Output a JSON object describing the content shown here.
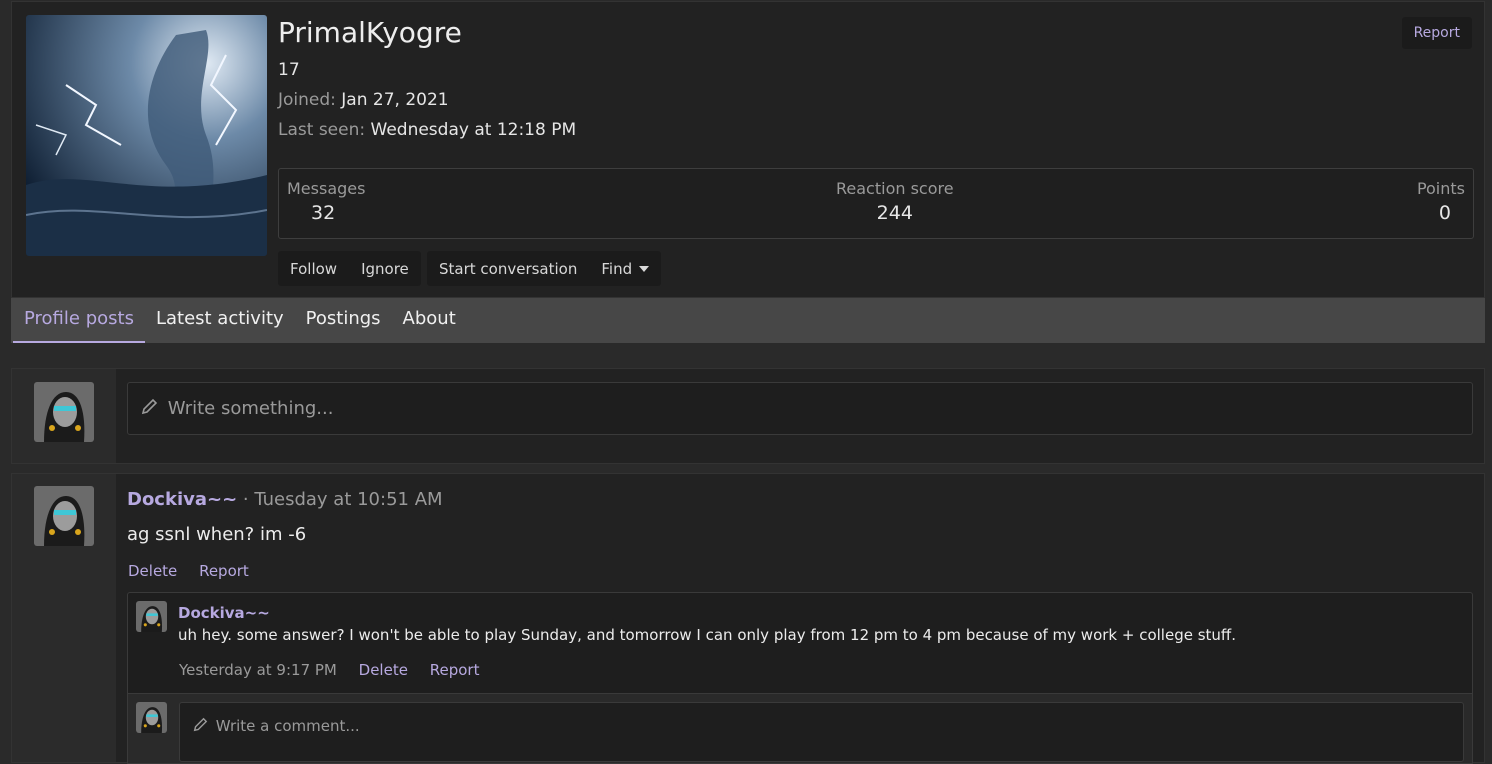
{
  "profile": {
    "username": "PrimalKyogre",
    "title": "17",
    "joined_label": "Joined:",
    "joined_value": "Jan 27, 2021",
    "last_seen_label": "Last seen:",
    "last_seen_value": "Wednesday at 12:18 PM",
    "report_label": "Report",
    "stats": {
      "messages_label": "Messages",
      "messages_value": "32",
      "reaction_label": "Reaction score",
      "reaction_value": "244",
      "points_label": "Points",
      "points_value": "0"
    },
    "buttons": {
      "follow": "Follow",
      "ignore": "Ignore",
      "start_conversation": "Start conversation",
      "find": "Find"
    }
  },
  "tabs": [
    "Profile posts",
    "Latest activity",
    "Postings",
    "About"
  ],
  "composer": {
    "placeholder": "Write something..."
  },
  "post": {
    "author": "Dockiva~~",
    "separator": " · ",
    "time": "Tuesday at 10:51 AM",
    "text": "ag ssnl when? im -6",
    "delete_label": "Delete",
    "report_label": "Report",
    "comment": {
      "author": "Dockiva~~",
      "text": "uh hey. some answer? I won't be able to play Sunday, and tomorrow I can only play from 12 pm to 4 pm because of my work + college stuff.",
      "time": "Yesterday at 9:17 PM",
      "delete_label": "Delete",
      "report_label": "Report"
    },
    "comment_placeholder": "Write a comment..."
  },
  "colors": {
    "accent": "#b7a9e0",
    "background": "#2a2a2a",
    "card": "#222222"
  }
}
